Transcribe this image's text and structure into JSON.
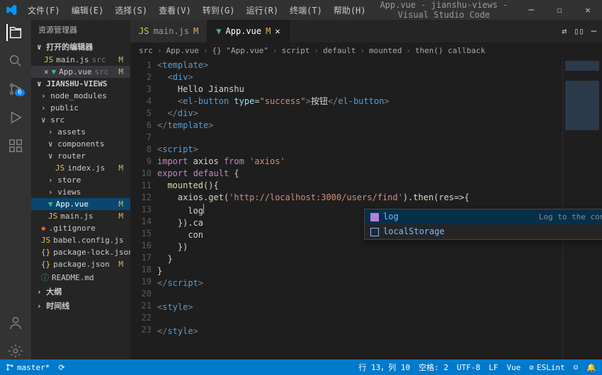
{
  "titlebar": {
    "menus": [
      "文件(F)",
      "编辑(E)",
      "选择(S)",
      "查看(V)",
      "转到(G)",
      "运行(R)",
      "终端(T)",
      "帮助(H)"
    ],
    "title": "App.vue - jianshu-views - Visual Studio Code"
  },
  "sidebar": {
    "header": "资源管理器",
    "openEditors": {
      "label": "打开的编辑器"
    },
    "project": "JIANSHU-VIEWS",
    "openFiles": [
      {
        "icon": "js",
        "name": "main.js",
        "meta": "src",
        "mark": "M"
      },
      {
        "icon": "vue",
        "name": "App.vue",
        "meta": "src",
        "mark": "M",
        "close": true
      }
    ],
    "tree": [
      {
        "type": "folder",
        "name": "node_modules",
        "depth": 0
      },
      {
        "type": "folder",
        "name": "public",
        "depth": 0
      },
      {
        "type": "folder",
        "name": "src",
        "depth": 0,
        "open": true
      },
      {
        "type": "folder",
        "name": "assets",
        "depth": 1
      },
      {
        "type": "folder",
        "name": "components",
        "depth": 1,
        "open": true
      },
      {
        "type": "folder",
        "name": "router",
        "depth": 1,
        "open": true
      },
      {
        "type": "file",
        "icon": "js",
        "name": "index.js",
        "depth": 2,
        "mark": "M"
      },
      {
        "type": "folder",
        "name": "store",
        "depth": 1
      },
      {
        "type": "folder",
        "name": "views",
        "depth": 1
      },
      {
        "type": "file",
        "icon": "vue",
        "name": "App.vue",
        "depth": 1,
        "mark": "M",
        "sel": true
      },
      {
        "type": "file",
        "icon": "js",
        "name": "main.js",
        "depth": 1,
        "mark": "M"
      },
      {
        "type": "file",
        "icon": "git",
        "name": ".gitignore",
        "depth": 0
      },
      {
        "type": "file",
        "icon": "js",
        "name": "babel.config.js",
        "depth": 0
      },
      {
        "type": "file",
        "icon": "json",
        "name": "package-lock.json",
        "depth": 0
      },
      {
        "type": "file",
        "icon": "json",
        "name": "package.json",
        "depth": 0,
        "mark": "M"
      },
      {
        "type": "file",
        "icon": "md",
        "name": "README.md",
        "depth": 0
      }
    ],
    "outline": "大纲",
    "timeline": "时间线"
  },
  "tabs": [
    {
      "icon": "js",
      "label": "main.js",
      "mark": "M"
    },
    {
      "icon": "vue",
      "label": "App.vue",
      "mark": "M",
      "active": true,
      "close": true
    }
  ],
  "breadcrumb": [
    "src",
    "App.vue",
    "{} \"App.vue\"",
    "script",
    "default",
    "mounted",
    "then() callback"
  ],
  "code": {
    "lines": [
      {
        "n": 1,
        "html": "<span class=tk-punc>&lt;</span><span class=tk-tag>template</span><span class=tk-punc>&gt;</span>"
      },
      {
        "n": 2,
        "html": "  <span class=tk-punc>&lt;</span><span class=tk-tag>div</span><span class=tk-punc>&gt;</span>"
      },
      {
        "n": 3,
        "html": "    <span class=tk-txt>Hello Jianshu</span>"
      },
      {
        "n": 4,
        "html": "    <span class=tk-punc>&lt;</span><span class=tk-tag>el-button</span> <span class=tk-attr>type</span>=<span class=tk-str>\"success\"</span><span class=tk-punc>&gt;</span><span class=tk-txt>按钮</span><span class=tk-punc>&lt;/</span><span class=tk-tag>el-button</span><span class=tk-punc>&gt;</span>"
      },
      {
        "n": 5,
        "html": "  <span class=tk-punc>&lt;/</span><span class=tk-tag>div</span><span class=tk-punc>&gt;</span>"
      },
      {
        "n": 6,
        "html": "<span class=tk-punc>&lt;/</span><span class=tk-tag>template</span><span class=tk-punc>&gt;</span>"
      },
      {
        "n": 7,
        "html": ""
      },
      {
        "n": 8,
        "html": "<span class=tk-punc>&lt;</span><span class=tk-tag>script</span><span class=tk-punc>&gt;</span>"
      },
      {
        "n": 9,
        "html": "<span class=tk-kw>import</span> <span class=tk-txt>axios</span> <span class=tk-kw>from</span> <span class=tk-str>'axios'</span>"
      },
      {
        "n": 10,
        "html": "<span class=tk-kw>export</span> <span class=tk-kw>default</span> <span class=tk-txt>{</span>"
      },
      {
        "n": 11,
        "html": "  <span class=tk-fn>mounted</span><span class=tk-txt>(){</span>"
      },
      {
        "n": 12,
        "html": "    <span class=tk-txt>axios.</span><span class=tk-fn>get</span><span class=tk-txt>(</span><span class=tk-str>'http://localhost:3000/users/find'</span><span class=tk-txt>).</span><span class=tk-fn>then</span><span class=tk-txt>(res=&gt;{</span>"
      },
      {
        "n": 13,
        "html": "      <span class=tk-txt>log</span><span style='border-left:1px solid #aeafad;height:14px;display:inline-block'></span>"
      },
      {
        "n": 14,
        "html": "    <span class=tk-txt>}).ca</span>"
      },
      {
        "n": 15,
        "html": "      <span class=tk-txt>con</span>"
      },
      {
        "n": 16,
        "html": "    <span class=tk-txt>})</span>"
      },
      {
        "n": 17,
        "html": "  <span class=tk-txt>}</span>"
      },
      {
        "n": 18,
        "html": "<span class=tk-txt>}</span>"
      },
      {
        "n": 19,
        "html": "<span class=tk-punc>&lt;/</span><span class=tk-tag>script</span><span class=tk-punc>&gt;</span>"
      },
      {
        "n": 20,
        "html": ""
      },
      {
        "n": 21,
        "html": "<span class=tk-punc>&lt;</span><span class=tk-tag>style</span><span class=tk-punc>&gt;</span>"
      },
      {
        "n": 22,
        "html": ""
      },
      {
        "n": 23,
        "html": "<span class=tk-punc>&lt;/</span><span class=tk-tag>style</span><span class=tk-punc>&gt;</span>"
      }
    ]
  },
  "suggest": {
    "items": [
      {
        "icon": "method",
        "label": "log",
        "hint": "Log to the console",
        "sel": true
      },
      {
        "icon": "var",
        "label": "localStorage"
      }
    ]
  },
  "status": {
    "branch": "master*",
    "sync": "",
    "pos": "行 13，列 10",
    "spaces": "空格: 2",
    "encoding": "UTF-8",
    "eol": "LF",
    "lang": "Vue",
    "eslint": "ESLint"
  },
  "scm_badge": "6"
}
